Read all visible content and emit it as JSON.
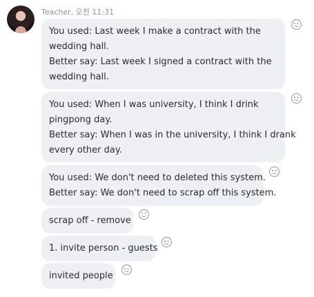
{
  "header": {
    "sender": "Teacher",
    "time": "오전 11:31"
  },
  "icons": {
    "avatar": "profile-photo",
    "reaction": "smiley-face-icon"
  },
  "messages": [
    {
      "lines": [
        "You used: Last week I make a contract with the",
        "wedding hall.",
        "Better say: Last week I signed a contract with the",
        "wedding hall."
      ]
    },
    {
      "lines": [
        "You used: When I was university, I think I drink",
        "pingpong day.",
        "Better say: When I was in the university, I think I drank",
        "every other day."
      ]
    },
    {
      "lines": [
        "You used: We don't need to deleted this system.",
        "Better say: We don't need to scrap off this system."
      ]
    },
    {
      "lines": [
        "scrap off - remove"
      ]
    },
    {
      "lines": [
        "1. invite person - guests"
      ]
    },
    {
      "lines": [
        "invited people"
      ]
    }
  ]
}
